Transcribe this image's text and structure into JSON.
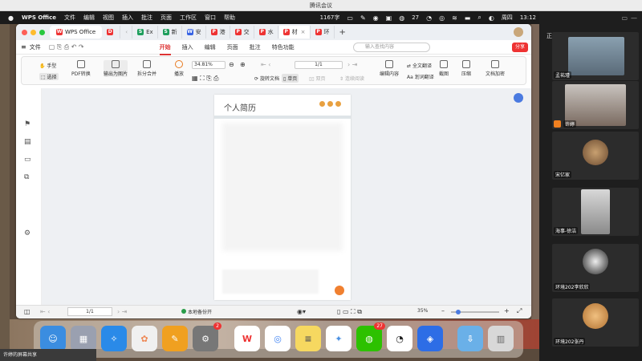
{
  "meeting": {
    "title": "腾讯会议",
    "speaking_label": "正在讲话:"
  },
  "menubar": {
    "app": "WPS Office",
    "items": [
      "文件",
      "编辑",
      "视图",
      "插入",
      "批注",
      "页面",
      "工作区",
      "窗口",
      "帮助"
    ],
    "word_count": "1167字",
    "wechat_badge": "27",
    "weekday": "周四",
    "time": "13:12"
  },
  "tabs": [
    {
      "label": "WPS Office",
      "color": "#e33",
      "icon": "W"
    },
    {
      "label": "Ex",
      "color": "#1e9e5c",
      "icon": "S"
    },
    {
      "label": "新",
      "color": "#1e9e5c",
      "icon": "S"
    },
    {
      "label": "安",
      "color": "#3662e3",
      "icon": "W"
    },
    {
      "label": "港",
      "color": "#e33",
      "icon": "P"
    },
    {
      "label": "交",
      "color": "#e33",
      "icon": "P"
    },
    {
      "label": "水",
      "color": "#e33",
      "icon": "P"
    },
    {
      "label": "材",
      "color": "#e33",
      "icon": "P"
    },
    {
      "label": "环",
      "color": "#e33",
      "icon": "P"
    }
  ],
  "ribbon": {
    "file": "文件",
    "tabs": [
      "开始",
      "插入",
      "编辑",
      "页面",
      "批注",
      "特色功能"
    ],
    "active": "开始",
    "search_placeholder": "输入查找内容",
    "share": "分享"
  },
  "tools": {
    "hand": "手型",
    "select": "选择",
    "pdf_convert": "PDF转换",
    "to_image": "输出为图片",
    "split_merge": "拆分合并",
    "play": "播放",
    "zoom": "34.81%",
    "page": "1/1",
    "rotate": "旋转文档",
    "single": "单页",
    "double": "双页",
    "continuous": "连续阅读",
    "edit": "编辑内容",
    "translate": "全文翻译",
    "word_translate": "划词翻译",
    "screenshot": "截图",
    "compress": "压缩",
    "encrypt": "文档加密"
  },
  "document": {
    "title": "个人简历"
  },
  "status": {
    "page": "1/1",
    "backup": "本地备份开",
    "zoom": "35%"
  },
  "participants": [
    "孟祐瑾",
    "许婷",
    "宋亿家",
    "海事-徐洁",
    "环境202李欣欣",
    "环境202张丹"
  ],
  "dock": {
    "settings_badge": "2",
    "wechat_badge": "27"
  },
  "share_note": "许婷的屏幕共享"
}
